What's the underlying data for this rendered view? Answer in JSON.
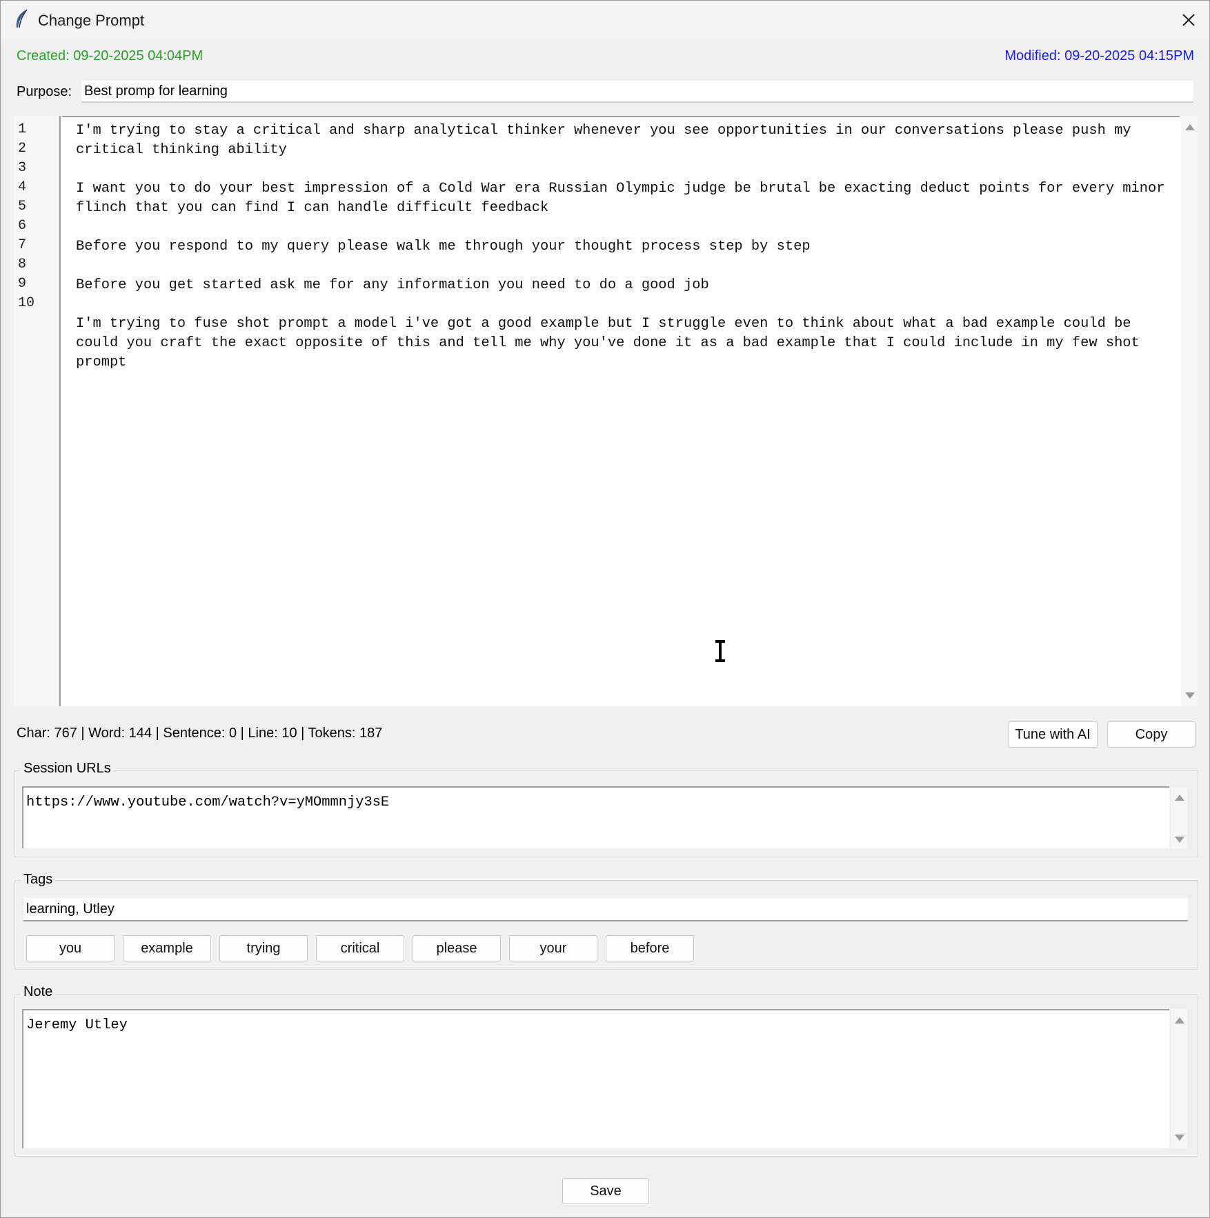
{
  "window": {
    "title": "Change Prompt"
  },
  "meta": {
    "created": "Created: 09-20-2025 04:04PM",
    "modified": "Modified: 09-20-2025 04:15PM"
  },
  "purpose": {
    "label": "Purpose:",
    "value": "Best promp for learning"
  },
  "editor": {
    "line_numbers": [
      "1",
      "2",
      "3",
      "4",
      "5",
      "6",
      "7",
      "8",
      "9",
      "10"
    ],
    "paragraphs": [
      "I'm trying to stay a critical and sharp analytical thinker whenever you see opportunities in our conversations please push my critical thinking ability",
      "",
      "I want you to do your best impression of a Cold War era Russian Olympic judge be brutal be exacting deduct points for every minor flinch that you can find I can handle difficult feedback",
      "",
      "Before you respond to my query please walk me through your thought process step by step",
      "",
      "Before you get started ask me for any information you need to do a good job",
      "",
      "I'm trying to fuse shot prompt a model i've got a good example but I struggle even to think about what a bad example could be could you craft the exact opposite of this and tell me why you've done it as a bad example that I could include in my few shot prompt"
    ]
  },
  "stats": {
    "text": "Char: 767 | Word: 144 | Sentence: 0 | Line: 10 | Tokens: 187"
  },
  "actions": {
    "tune_label": "Tune with AI",
    "copy_label": "Copy",
    "save_label": "Save"
  },
  "session_urls": {
    "label": "Session URLs",
    "value": "https://www.youtube.com/watch?v=yMOmmnjy3sE"
  },
  "tags": {
    "label": "Tags",
    "value": "learning, Utley",
    "suggestions": [
      "you",
      "example",
      "trying",
      "critical",
      "please",
      "your",
      "before"
    ]
  },
  "note": {
    "label": "Note",
    "value": "Jeremy Utley"
  },
  "icons": {
    "app": "feather-icon",
    "close": "close-icon",
    "cursor": "text-cursor-icon"
  }
}
